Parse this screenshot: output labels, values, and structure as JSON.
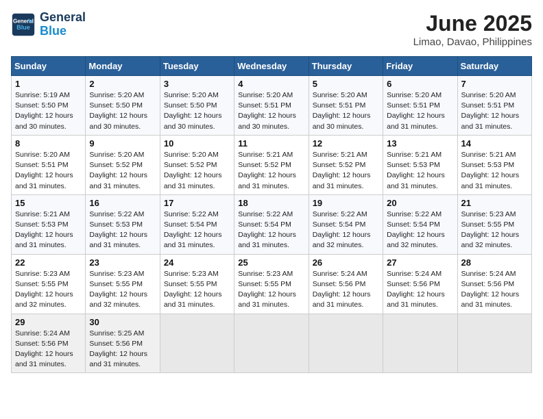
{
  "header": {
    "logo_line1": "General",
    "logo_line2": "Blue",
    "title": "June 2025",
    "subtitle": "Limao, Davao, Philippines"
  },
  "weekdays": [
    "Sunday",
    "Monday",
    "Tuesday",
    "Wednesday",
    "Thursday",
    "Friday",
    "Saturday"
  ],
  "weeks": [
    [
      {
        "day": "1",
        "info": "Sunrise: 5:19 AM\nSunset: 5:50 PM\nDaylight: 12 hours\nand 30 minutes."
      },
      {
        "day": "2",
        "info": "Sunrise: 5:20 AM\nSunset: 5:50 PM\nDaylight: 12 hours\nand 30 minutes."
      },
      {
        "day": "3",
        "info": "Sunrise: 5:20 AM\nSunset: 5:50 PM\nDaylight: 12 hours\nand 30 minutes."
      },
      {
        "day": "4",
        "info": "Sunrise: 5:20 AM\nSunset: 5:51 PM\nDaylight: 12 hours\nand 30 minutes."
      },
      {
        "day": "5",
        "info": "Sunrise: 5:20 AM\nSunset: 5:51 PM\nDaylight: 12 hours\nand 30 minutes."
      },
      {
        "day": "6",
        "info": "Sunrise: 5:20 AM\nSunset: 5:51 PM\nDaylight: 12 hours\nand 31 minutes."
      },
      {
        "day": "7",
        "info": "Sunrise: 5:20 AM\nSunset: 5:51 PM\nDaylight: 12 hours\nand 31 minutes."
      }
    ],
    [
      {
        "day": "8",
        "info": "Sunrise: 5:20 AM\nSunset: 5:51 PM\nDaylight: 12 hours\nand 31 minutes."
      },
      {
        "day": "9",
        "info": "Sunrise: 5:20 AM\nSunset: 5:52 PM\nDaylight: 12 hours\nand 31 minutes."
      },
      {
        "day": "10",
        "info": "Sunrise: 5:20 AM\nSunset: 5:52 PM\nDaylight: 12 hours\nand 31 minutes."
      },
      {
        "day": "11",
        "info": "Sunrise: 5:21 AM\nSunset: 5:52 PM\nDaylight: 12 hours\nand 31 minutes."
      },
      {
        "day": "12",
        "info": "Sunrise: 5:21 AM\nSunset: 5:52 PM\nDaylight: 12 hours\nand 31 minutes."
      },
      {
        "day": "13",
        "info": "Sunrise: 5:21 AM\nSunset: 5:53 PM\nDaylight: 12 hours\nand 31 minutes."
      },
      {
        "day": "14",
        "info": "Sunrise: 5:21 AM\nSunset: 5:53 PM\nDaylight: 12 hours\nand 31 minutes."
      }
    ],
    [
      {
        "day": "15",
        "info": "Sunrise: 5:21 AM\nSunset: 5:53 PM\nDaylight: 12 hours\nand 31 minutes."
      },
      {
        "day": "16",
        "info": "Sunrise: 5:22 AM\nSunset: 5:53 PM\nDaylight: 12 hours\nand 31 minutes."
      },
      {
        "day": "17",
        "info": "Sunrise: 5:22 AM\nSunset: 5:54 PM\nDaylight: 12 hours\nand 31 minutes."
      },
      {
        "day": "18",
        "info": "Sunrise: 5:22 AM\nSunset: 5:54 PM\nDaylight: 12 hours\nand 31 minutes."
      },
      {
        "day": "19",
        "info": "Sunrise: 5:22 AM\nSunset: 5:54 PM\nDaylight: 12 hours\nand 32 minutes."
      },
      {
        "day": "20",
        "info": "Sunrise: 5:22 AM\nSunset: 5:54 PM\nDaylight: 12 hours\nand 32 minutes."
      },
      {
        "day": "21",
        "info": "Sunrise: 5:23 AM\nSunset: 5:55 PM\nDaylight: 12 hours\nand 32 minutes."
      }
    ],
    [
      {
        "day": "22",
        "info": "Sunrise: 5:23 AM\nSunset: 5:55 PM\nDaylight: 12 hours\nand 32 minutes."
      },
      {
        "day": "23",
        "info": "Sunrise: 5:23 AM\nSunset: 5:55 PM\nDaylight: 12 hours\nand 32 minutes."
      },
      {
        "day": "24",
        "info": "Sunrise: 5:23 AM\nSunset: 5:55 PM\nDaylight: 12 hours\nand 31 minutes."
      },
      {
        "day": "25",
        "info": "Sunrise: 5:23 AM\nSunset: 5:55 PM\nDaylight: 12 hours\nand 31 minutes."
      },
      {
        "day": "26",
        "info": "Sunrise: 5:24 AM\nSunset: 5:56 PM\nDaylight: 12 hours\nand 31 minutes."
      },
      {
        "day": "27",
        "info": "Sunrise: 5:24 AM\nSunset: 5:56 PM\nDaylight: 12 hours\nand 31 minutes."
      },
      {
        "day": "28",
        "info": "Sunrise: 5:24 AM\nSunset: 5:56 PM\nDaylight: 12 hours\nand 31 minutes."
      }
    ],
    [
      {
        "day": "29",
        "info": "Sunrise: 5:24 AM\nSunset: 5:56 PM\nDaylight: 12 hours\nand 31 minutes."
      },
      {
        "day": "30",
        "info": "Sunrise: 5:25 AM\nSunset: 5:56 PM\nDaylight: 12 hours\nand 31 minutes."
      },
      {
        "day": "",
        "info": ""
      },
      {
        "day": "",
        "info": ""
      },
      {
        "day": "",
        "info": ""
      },
      {
        "day": "",
        "info": ""
      },
      {
        "day": "",
        "info": ""
      }
    ]
  ]
}
